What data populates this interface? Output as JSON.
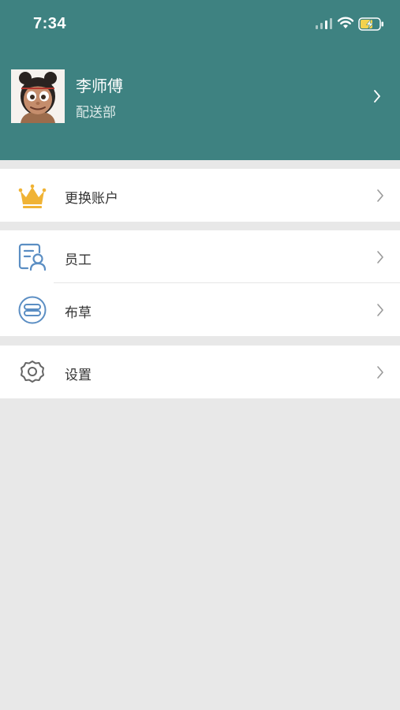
{
  "status_bar": {
    "time": "7:34"
  },
  "profile": {
    "name": "李师傅",
    "department": "配送部"
  },
  "menu": {
    "switch_account": {
      "label": "更换账户",
      "icon": "crown-icon"
    },
    "staff": {
      "label": "员工",
      "icon": "staff-card-icon"
    },
    "cloth_grass": {
      "label": "布草",
      "icon": "cloth-icon"
    },
    "settings": {
      "label": "设置",
      "icon": "gear-icon"
    }
  },
  "colors": {
    "header": "#3e8281",
    "crown": "#f0b335",
    "icon_blue": "#5b8ec3",
    "background": "#e8e8e8"
  }
}
